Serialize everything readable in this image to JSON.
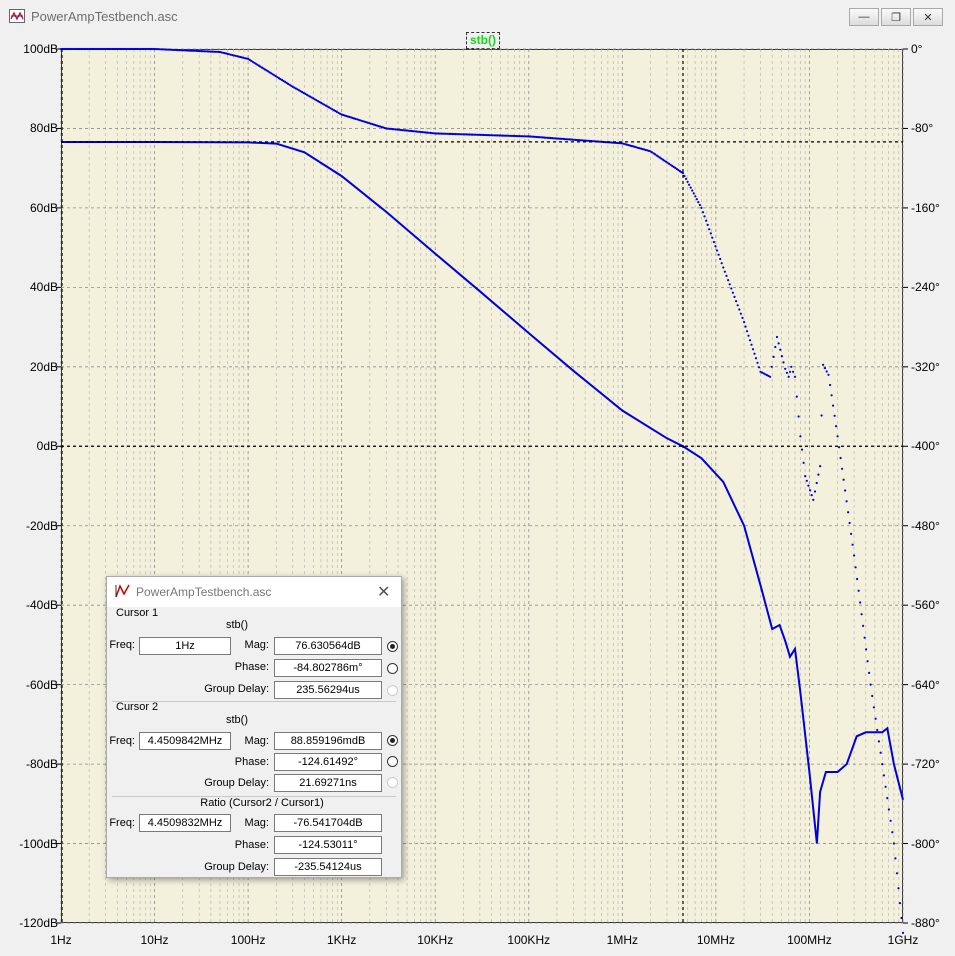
{
  "window": {
    "title": "PowerAmpTestbench.asc"
  },
  "trace_label": "stb()",
  "chart_data": {
    "type": "line",
    "x_scale": "log",
    "x_ticks": [
      "1Hz",
      "10Hz",
      "100Hz",
      "1KHz",
      "10KHz",
      "100KHz",
      "1MHz",
      "10MHz",
      "100MHz",
      "1GHz"
    ],
    "x_range_hz": [
      1,
      1000000000
    ],
    "y_left_ticks": [
      "100dB",
      "80dB",
      "60dB",
      "40dB",
      "20dB",
      "0dB",
      "-20dB",
      "-40dB",
      "-60dB",
      "-80dB",
      "-100dB",
      "-120dB"
    ],
    "y_left_range": [
      -120,
      100
    ],
    "y_right_ticks": [
      "0°",
      "-80°",
      "-160°",
      "-240°",
      "-320°",
      "-400°",
      "-480°",
      "-560°",
      "-640°",
      "-720°",
      "-800°",
      "-880°"
    ],
    "y_right_range": [
      -880,
      0
    ],
    "series": [
      {
        "style": "solid",
        "color": "#0000dd",
        "axis": "left",
        "points": [
          [
            1,
            76.6
          ],
          [
            10,
            76.6
          ],
          [
            100,
            76.5
          ],
          [
            200,
            76.2
          ],
          [
            400,
            74
          ],
          [
            1000,
            68
          ],
          [
            3000,
            59
          ],
          [
            10000,
            48.5
          ],
          [
            30000,
            39
          ],
          [
            100000,
            28.5
          ],
          [
            300000,
            19
          ],
          [
            1000000,
            9
          ],
          [
            3000000,
            2
          ],
          [
            4450000,
            0
          ],
          [
            7000000,
            -3
          ],
          [
            12000000,
            -9
          ],
          [
            20000000,
            -20
          ],
          [
            30000000,
            -35
          ],
          [
            40000000,
            -46
          ],
          [
            48000000,
            -45
          ],
          [
            55000000,
            -49
          ],
          [
            62000000,
            -53
          ],
          [
            70000000,
            -51
          ],
          [
            80000000,
            -62
          ],
          [
            100000000,
            -82
          ],
          [
            120000000,
            -100
          ],
          [
            130000000,
            -87
          ],
          [
            150000000,
            -82
          ],
          [
            200000000,
            -82
          ],
          [
            250000000,
            -80
          ],
          [
            320000000,
            -73
          ],
          [
            400000000,
            -72
          ],
          [
            600000000,
            -72
          ],
          [
            680000000,
            -71
          ],
          [
            800000000,
            -80
          ],
          [
            1000000000,
            -89
          ]
        ]
      },
      {
        "style": "dotted",
        "color": "#0000dd",
        "axis": "right",
        "points": [
          [
            1,
            0
          ],
          [
            10,
            0
          ],
          [
            50,
            -3
          ],
          [
            100,
            -10
          ],
          [
            300,
            -38
          ],
          [
            1000,
            -66
          ],
          [
            3000,
            -80
          ],
          [
            10000,
            -85
          ],
          [
            100000,
            -88
          ],
          [
            1000000,
            -95
          ],
          [
            2000000,
            -103
          ],
          [
            4450000,
            -125
          ],
          [
            7000000,
            -160
          ],
          [
            12000000,
            -220
          ],
          [
            20000000,
            -275
          ],
          [
            30000000,
            -325
          ],
          [
            38000000,
            -330
          ],
          [
            45000000,
            -290
          ],
          [
            55000000,
            -322
          ],
          [
            60000000,
            -330
          ],
          [
            64000000,
            -320
          ],
          [
            70000000,
            -330
          ],
          [
            80000000,
            -390
          ],
          [
            90000000,
            -430
          ],
          [
            110000000,
            -454
          ],
          [
            130000000,
            -420
          ],
          [
            140000000,
            -318
          ],
          [
            160000000,
            -328
          ],
          [
            200000000,
            -390
          ],
          [
            300000000,
            -510
          ],
          [
            450000000,
            -640
          ],
          [
            600000000,
            -720
          ],
          [
            800000000,
            -800
          ],
          [
            1000000000,
            -890
          ]
        ]
      }
    ],
    "crosshair": {
      "freq_hz": 4450000,
      "y_db": 0,
      "h2_db": 76.63
    }
  },
  "dialog": {
    "title": "PowerAmpTestbench.asc",
    "cursor1": {
      "label": "Cursor 1",
      "trace": "stb()",
      "freq_label": "Freq:",
      "freq": "1Hz",
      "mag_label": "Mag:",
      "mag": "76.630564dB",
      "phase_label": "Phase:",
      "phase": "-84.802786m°",
      "gd_label": "Group Delay:",
      "gd": "235.56294us"
    },
    "cursor2": {
      "label": "Cursor 2",
      "trace": "stb()",
      "freq_label": "Freq:",
      "freq": "4.4509842MHz",
      "mag_label": "Mag:",
      "mag": "88.859196mdB",
      "phase_label": "Phase:",
      "phase": "-124.61492°",
      "gd_label": "Group Delay:",
      "gd": "21.69271ns"
    },
    "ratio": {
      "label": "Ratio (Cursor2 / Cursor1)",
      "freq_label": "Freq:",
      "freq": "4.4509832MHz",
      "mag_label": "Mag:",
      "mag": "-76.541704dB",
      "phase_label": "Phase:",
      "phase": "-124.53011°",
      "gd_label": "Group Delay:",
      "gd": "-235.54124us"
    }
  }
}
